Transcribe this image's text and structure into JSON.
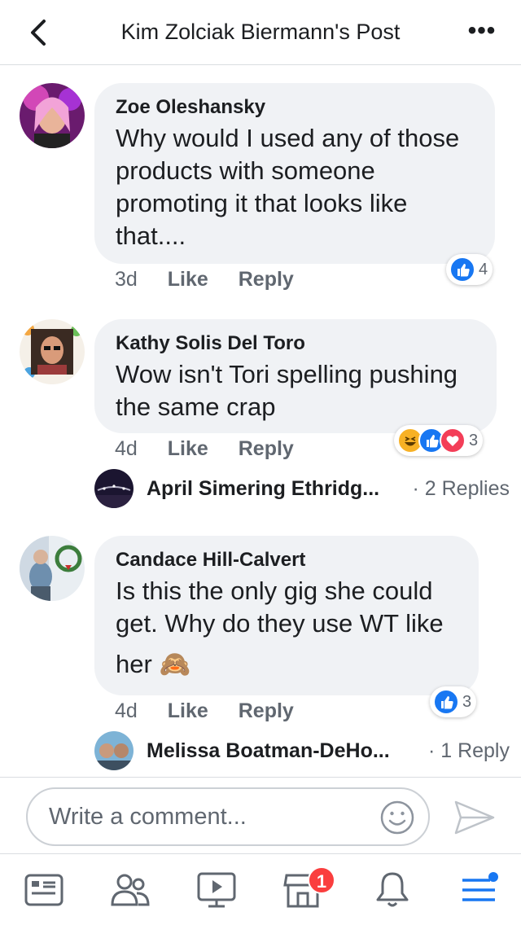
{
  "header": {
    "title": "Kim Zolciak Biermann's Post",
    "more_label": "•••"
  },
  "comments": [
    {
      "author": "Zoe Oleshansky",
      "text": "Why would I used any of those products with someone promoting it that looks like that....",
      "time": "3d",
      "like_label": "Like",
      "reply_label": "Reply",
      "reactions": [
        "like"
      ],
      "reaction_count": "4"
    },
    {
      "author": "Kathy Solis Del Toro",
      "text": "Wow isn't Tori spelling pushing the same crap",
      "time": "4d",
      "like_label": "Like",
      "reply_label": "Reply",
      "reactions": [
        "haha",
        "like",
        "love"
      ],
      "reaction_count": "3",
      "reply_preview": {
        "name": "April Simering Ethridg...",
        "count": "· 2 Replies"
      }
    },
    {
      "author": "Candace Hill-Calvert",
      "text_line1": "Is this the only gig she could get. Why do they use WT like",
      "text_line2": "her",
      "emoji": "🙈",
      "time": "4d",
      "like_label": "Like",
      "reply_label": "Reply",
      "reactions": [
        "like"
      ],
      "reaction_count": "3",
      "reply_preview": {
        "name": "Melissa Boatman-DeHo...",
        "count": "· 1 Reply"
      }
    }
  ],
  "composer": {
    "placeholder": "Write a comment...",
    "emoji_icon": "smiley-icon",
    "send_icon": "send-icon"
  },
  "tabbar": {
    "items": [
      "news-feed-icon",
      "friends-icon",
      "watch-icon",
      "marketplace-icon",
      "notifications-icon",
      "menu-icon"
    ],
    "marketplace_badge": "1"
  },
  "colors": {
    "accent": "#1877f2",
    "bubble": "#f0f2f5",
    "badge": "#fa3e3e",
    "love": "#f33e58",
    "haha": "#f7b125"
  }
}
